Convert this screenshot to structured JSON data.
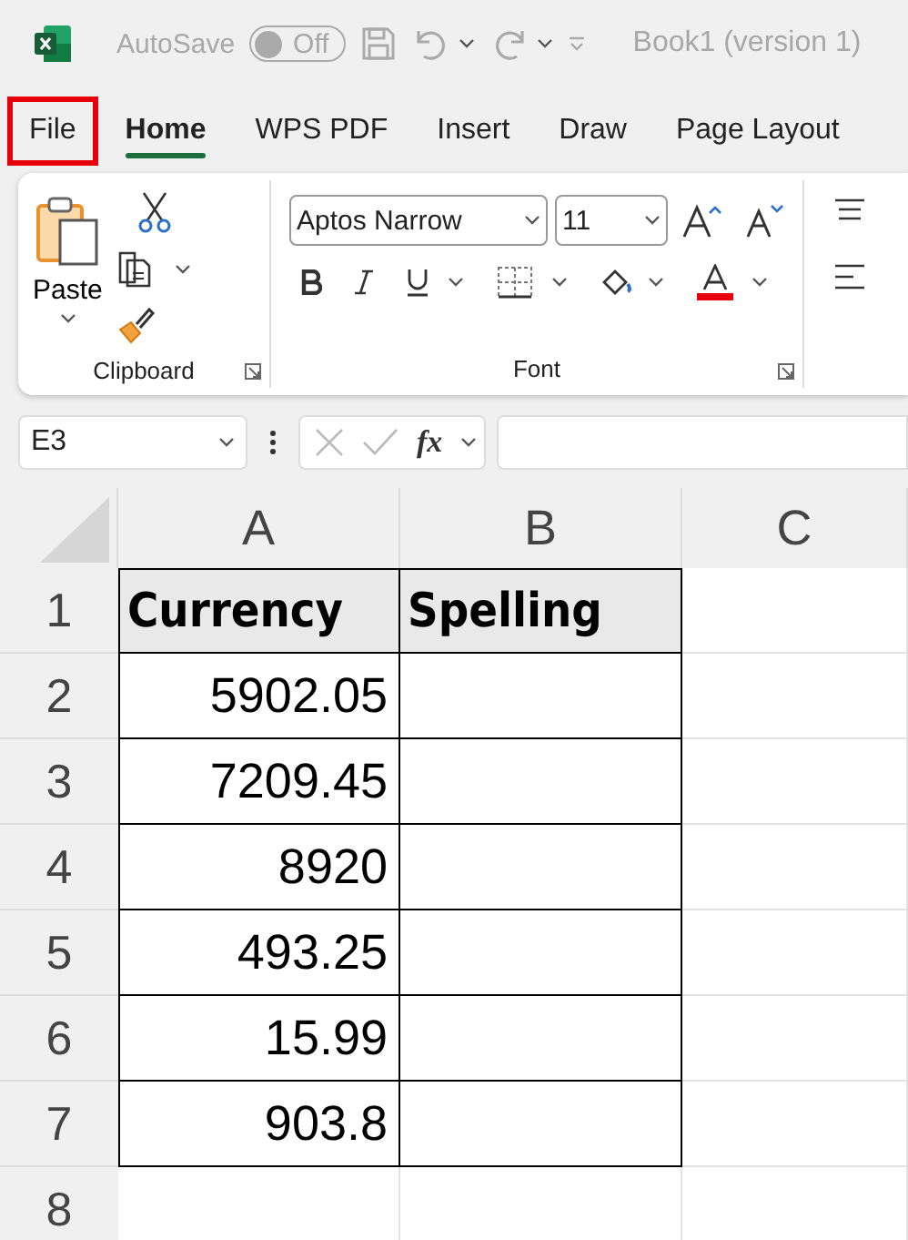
{
  "title_bar": {
    "autosave": {
      "label": "AutoSave",
      "on": false,
      "state_text": "Off"
    },
    "document_title": "Book1 (version 1)"
  },
  "tabs": [
    {
      "label": "File",
      "selected": false,
      "highlighted": true
    },
    {
      "label": "Home",
      "selected": true,
      "highlighted": false
    },
    {
      "label": "WPS PDF",
      "selected": false,
      "highlighted": false
    },
    {
      "label": "Insert",
      "selected": false,
      "highlighted": false
    },
    {
      "label": "Draw",
      "selected": false,
      "highlighted": false
    },
    {
      "label": "Page Layout",
      "selected": false,
      "highlighted": false
    }
  ],
  "ribbon": {
    "clipboard": {
      "paste_label": "Paste",
      "group_label": "Clipboard"
    },
    "font": {
      "font_name": "Aptos Narrow",
      "font_size": "11",
      "group_label": "Font"
    }
  },
  "formula_bar": {
    "name_box": "E3",
    "function_label": "fx"
  },
  "sheet": {
    "columns": [
      "A",
      "B",
      "C"
    ],
    "rows": [
      {
        "number": "1",
        "kind": "header",
        "cells": [
          "Currency",
          "Spelling"
        ]
      },
      {
        "number": "2",
        "kind": "data",
        "cells": [
          "5902.05"
        ]
      },
      {
        "number": "3",
        "kind": "data",
        "cells": [
          "7209.45"
        ]
      },
      {
        "number": "4",
        "kind": "data",
        "cells": [
          "8920"
        ]
      },
      {
        "number": "5",
        "kind": "data",
        "cells": [
          "493.25"
        ]
      },
      {
        "number": "6",
        "kind": "data",
        "cells": [
          "15.99"
        ]
      },
      {
        "number": "7",
        "kind": "data",
        "cells": [
          "903.8"
        ]
      },
      {
        "number": "8",
        "kind": "empty"
      }
    ]
  }
}
